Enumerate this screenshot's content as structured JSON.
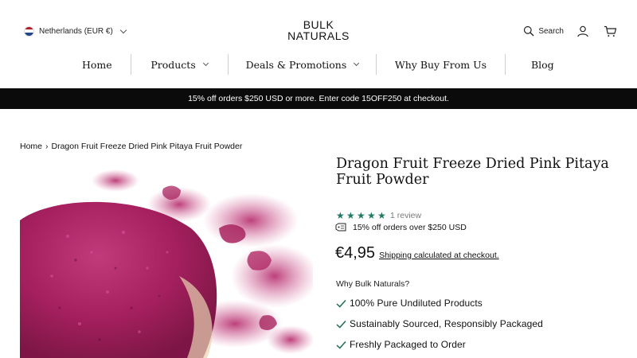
{
  "header": {
    "country_label": "Netherlands (EUR €)",
    "logo_line1": "BULK",
    "logo_line2": "NATURALS",
    "search_label": "Search",
    "icons": [
      "nl-flag-icon",
      "chevron-down-icon",
      "search-icon",
      "account-icon",
      "cart-icon"
    ]
  },
  "nav": {
    "items": [
      {
        "label": "Home"
      },
      {
        "label": "Products"
      },
      {
        "label": "Deals & Promotions"
      },
      {
        "label": "Why Buy From Us"
      },
      {
        "label": "Blog"
      }
    ]
  },
  "announcement": {
    "text": "15% off orders $250 USD or more. Enter code 15OFF250 at checkout."
  },
  "breadcrumb": {
    "home": "Home",
    "separator": "›",
    "current": "Dragon Fruit Freeze Dried Pink Pitaya Fruit Powder"
  },
  "product": {
    "title": "Dragon Fruit Freeze Dried Pink Pitaya Fruit Powder",
    "rating_stars": 5,
    "reviews_label": "1 review",
    "promo_text": "15% off orders over $250 USD",
    "price": "€4,95",
    "shipping_link": "Shipping calculated at checkout.",
    "why_heading": "Why Bulk Naturals?",
    "benefits": [
      "100% Pure Undiluted Products",
      "Sustainably Sourced, Responsibly Packaged",
      "Freshly Packaged to Order"
    ]
  },
  "colors": {
    "announcement_bg": "#0b0b0b",
    "star_color": "#1f7a63",
    "check_color": "#1f6e4f",
    "powder_color": "#a6205f"
  }
}
